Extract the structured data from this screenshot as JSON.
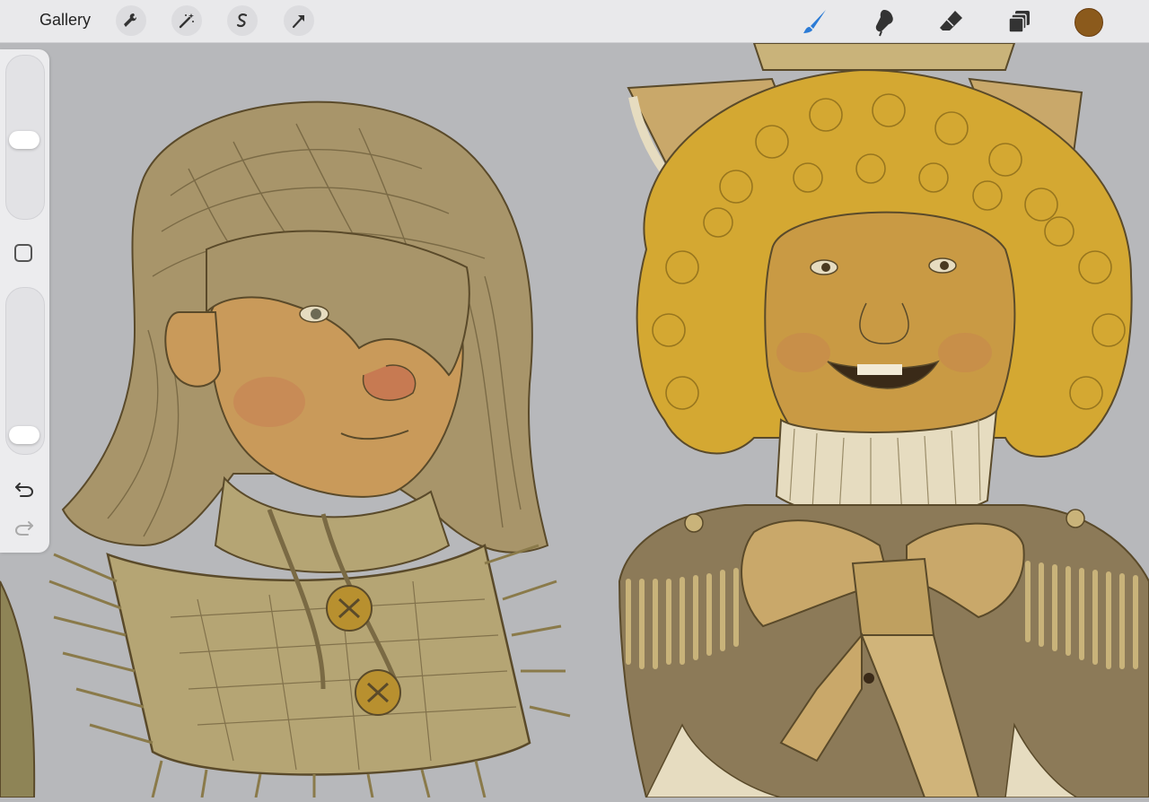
{
  "app": {
    "gallery_label": "Gallery"
  },
  "toolbar": {
    "left_tools": [
      "wrench-icon",
      "magic-wand-icon",
      "selection-s-icon",
      "transform-arrow-icon"
    ],
    "right_tools": [
      "brush-icon",
      "smudge-icon",
      "eraser-icon",
      "layers-icon"
    ],
    "active_tool": "brush",
    "accent_color": "#2b7bd6",
    "current_color": "#8b5a1c"
  },
  "sidebar": {
    "brush_size_level": 0.48,
    "opacity_level": 0.05
  },
  "artwork": {
    "palette": {
      "background": "#b7b8bb",
      "hair_left": "#a8956a",
      "hair_right": "#d4a832",
      "skin": "#c99a5a",
      "cheek": "#c77a52",
      "outfit": "#b5a574",
      "jacket": "#8c7a58",
      "bow": "#c9a86a",
      "ruffle": "#e6dcc0",
      "line": "#5a4a2a"
    }
  }
}
